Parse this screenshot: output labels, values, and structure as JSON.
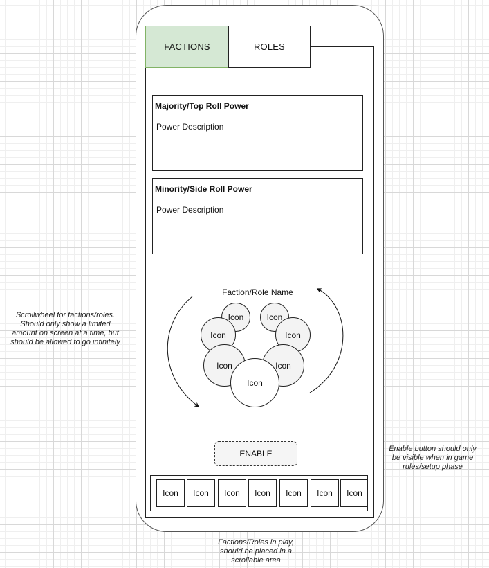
{
  "tabs": {
    "factions": "FACTIONS",
    "roles": "ROLES"
  },
  "powers": [
    {
      "title": "Majority/Top Roll Power",
      "description": "Power Description"
    },
    {
      "title": "Minority/Side Roll Power",
      "description": "Power Description"
    }
  ],
  "wheel": {
    "name": "Faction/Role Name",
    "icons": [
      "Icon",
      "Icon",
      "Icon",
      "Icon",
      "Icon",
      "Icon",
      "Icon"
    ]
  },
  "enable_button": "ENABLE",
  "tray_icons": [
    "Icon",
    "Icon",
    "Icon",
    "Icon",
    "Icon",
    "Icon",
    "Icon"
  ],
  "notes": {
    "scrollwheel": "Scrollwheel for factions/roles. Should only show a limited amount on screen at a time, but should be allowed to go infinitely",
    "enable": "Enable button should only be visible when in game rules/setup phase",
    "tray": "Factions/Roles in play, should be placed in a scrollable area"
  },
  "colors": {
    "active_tab_fill": "#d5e8d4",
    "active_tab_border": "#82b366"
  }
}
